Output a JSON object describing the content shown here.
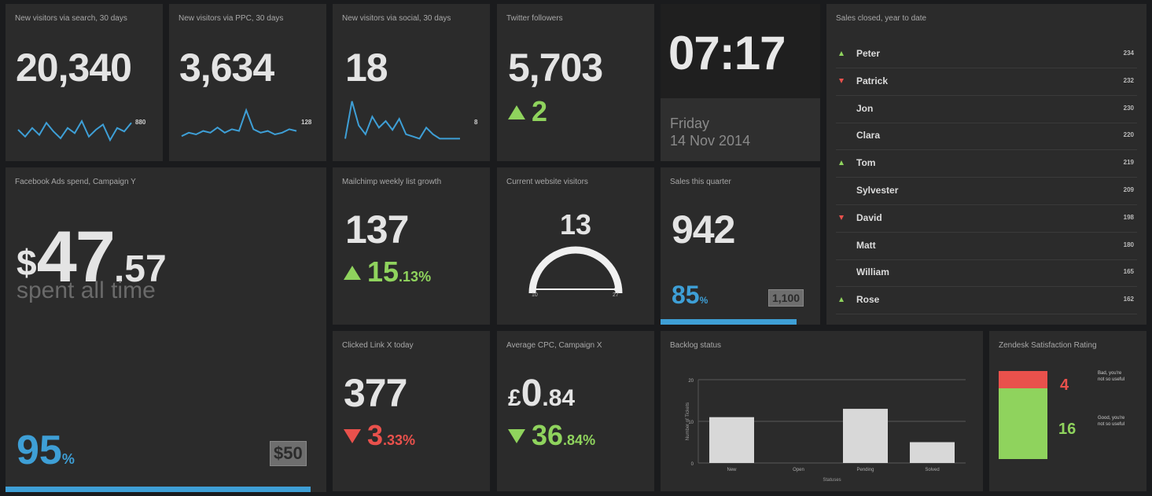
{
  "tiles": {
    "search": {
      "title": "New visitors via search, 30 days",
      "value": "20,340",
      "spark_max": "880",
      "spark": [
        0.5,
        0.3,
        0.55,
        0.35,
        0.7,
        0.45,
        0.25,
        0.55,
        0.4,
        0.75,
        0.3,
        0.5,
        0.65,
        0.2,
        0.55,
        0.45,
        0.7
      ]
    },
    "ppc": {
      "title": "New visitors via PPC, 30 days",
      "value": "3,634",
      "spark_max": "128",
      "spark": [
        0.2,
        0.3,
        0.25,
        0.35,
        0.3,
        0.45,
        0.3,
        0.4,
        0.35,
        0.95,
        0.4,
        0.3,
        0.35,
        0.25,
        0.3,
        0.4,
        0.35
      ]
    },
    "social": {
      "title": "New visitors via social, 30 days",
      "value": "18",
      "spark_max": "8",
      "spark": [
        0.1,
        0.95,
        0.4,
        0.2,
        0.6,
        0.35,
        0.5,
        0.3,
        0.55,
        0.2,
        0.15,
        0.1,
        0.35,
        0.2,
        0.1,
        0.1,
        0.1,
        0.1
      ]
    },
    "twitter": {
      "title": "Twitter followers",
      "value": "5,703",
      "change": "2"
    },
    "clock": {
      "time": "07:17",
      "day": "Friday",
      "date": "14 Nov 2014"
    },
    "facebook": {
      "title": "Facebook Ads spend, Campaign Y",
      "currency": "$",
      "whole": "47",
      "decimal": ".57",
      "caption": "spent all time",
      "percent": "95",
      "percent_unit": "%",
      "target": "$50",
      "progress": 0.95
    },
    "mailchimp": {
      "title": "Mailchimp weekly list growth",
      "value": "137",
      "change_whole": "15",
      "change_dec": ".13%"
    },
    "visitors": {
      "title": "Current website visitors",
      "value": "13",
      "min": "10",
      "max": "27",
      "level": 0.18
    },
    "sales_quarter": {
      "title": "Sales this quarter",
      "value": "942",
      "percent": "85",
      "percent_unit": "%",
      "target": "1,100",
      "progress": 0.85
    },
    "leaderboard": {
      "title": "Sales closed, year to date",
      "rows": [
        {
          "name": "Peter",
          "value": "234",
          "trend": "up"
        },
        {
          "name": "Patrick",
          "value": "232",
          "trend": "down"
        },
        {
          "name": "Jon",
          "value": "230",
          "trend": ""
        },
        {
          "name": "Clara",
          "value": "220",
          "trend": ""
        },
        {
          "name": "Tom",
          "value": "219",
          "trend": "up"
        },
        {
          "name": "Sylvester",
          "value": "209",
          "trend": ""
        },
        {
          "name": "David",
          "value": "198",
          "trend": "down"
        },
        {
          "name": "Matt",
          "value": "180",
          "trend": ""
        },
        {
          "name": "William",
          "value": "165",
          "trend": ""
        },
        {
          "name": "Rose",
          "value": "162",
          "trend": "up"
        }
      ]
    },
    "closed_link": {
      "title": "Clicked Link X today",
      "value": "377",
      "change_whole": "3",
      "change_dec": ".33%"
    },
    "cpc": {
      "title": "Average CPC, Campaign X",
      "currency": "£",
      "whole": "0",
      "decimal": ".84",
      "change_whole": "36",
      "change_dec": ".84%"
    },
    "backlog": {
      "title": "Backlog status"
    },
    "satisfaction": {
      "title": "Zendesk Satisfaction Rating",
      "bad": "4",
      "good": "16",
      "bad_label": "Bad, you're not so useful",
      "good_label": "Good, you're not so useful"
    }
  },
  "chart_data": {
    "type": "bar",
    "title": "Backlog status",
    "categories": [
      "New",
      "Open",
      "Pending",
      "Solved"
    ],
    "values": [
      11,
      0,
      13,
      5
    ],
    "ylim": [
      0,
      20
    ],
    "yticks": [
      0,
      10,
      20
    ],
    "ylabel": "Number of Tickets",
    "xlabel": "Statuses",
    "grid": true
  },
  "colors": {
    "up": "#8fd35d",
    "down": "#e9514c",
    "accent": "#3e9fd6",
    "tile": "#2b2b2b"
  }
}
